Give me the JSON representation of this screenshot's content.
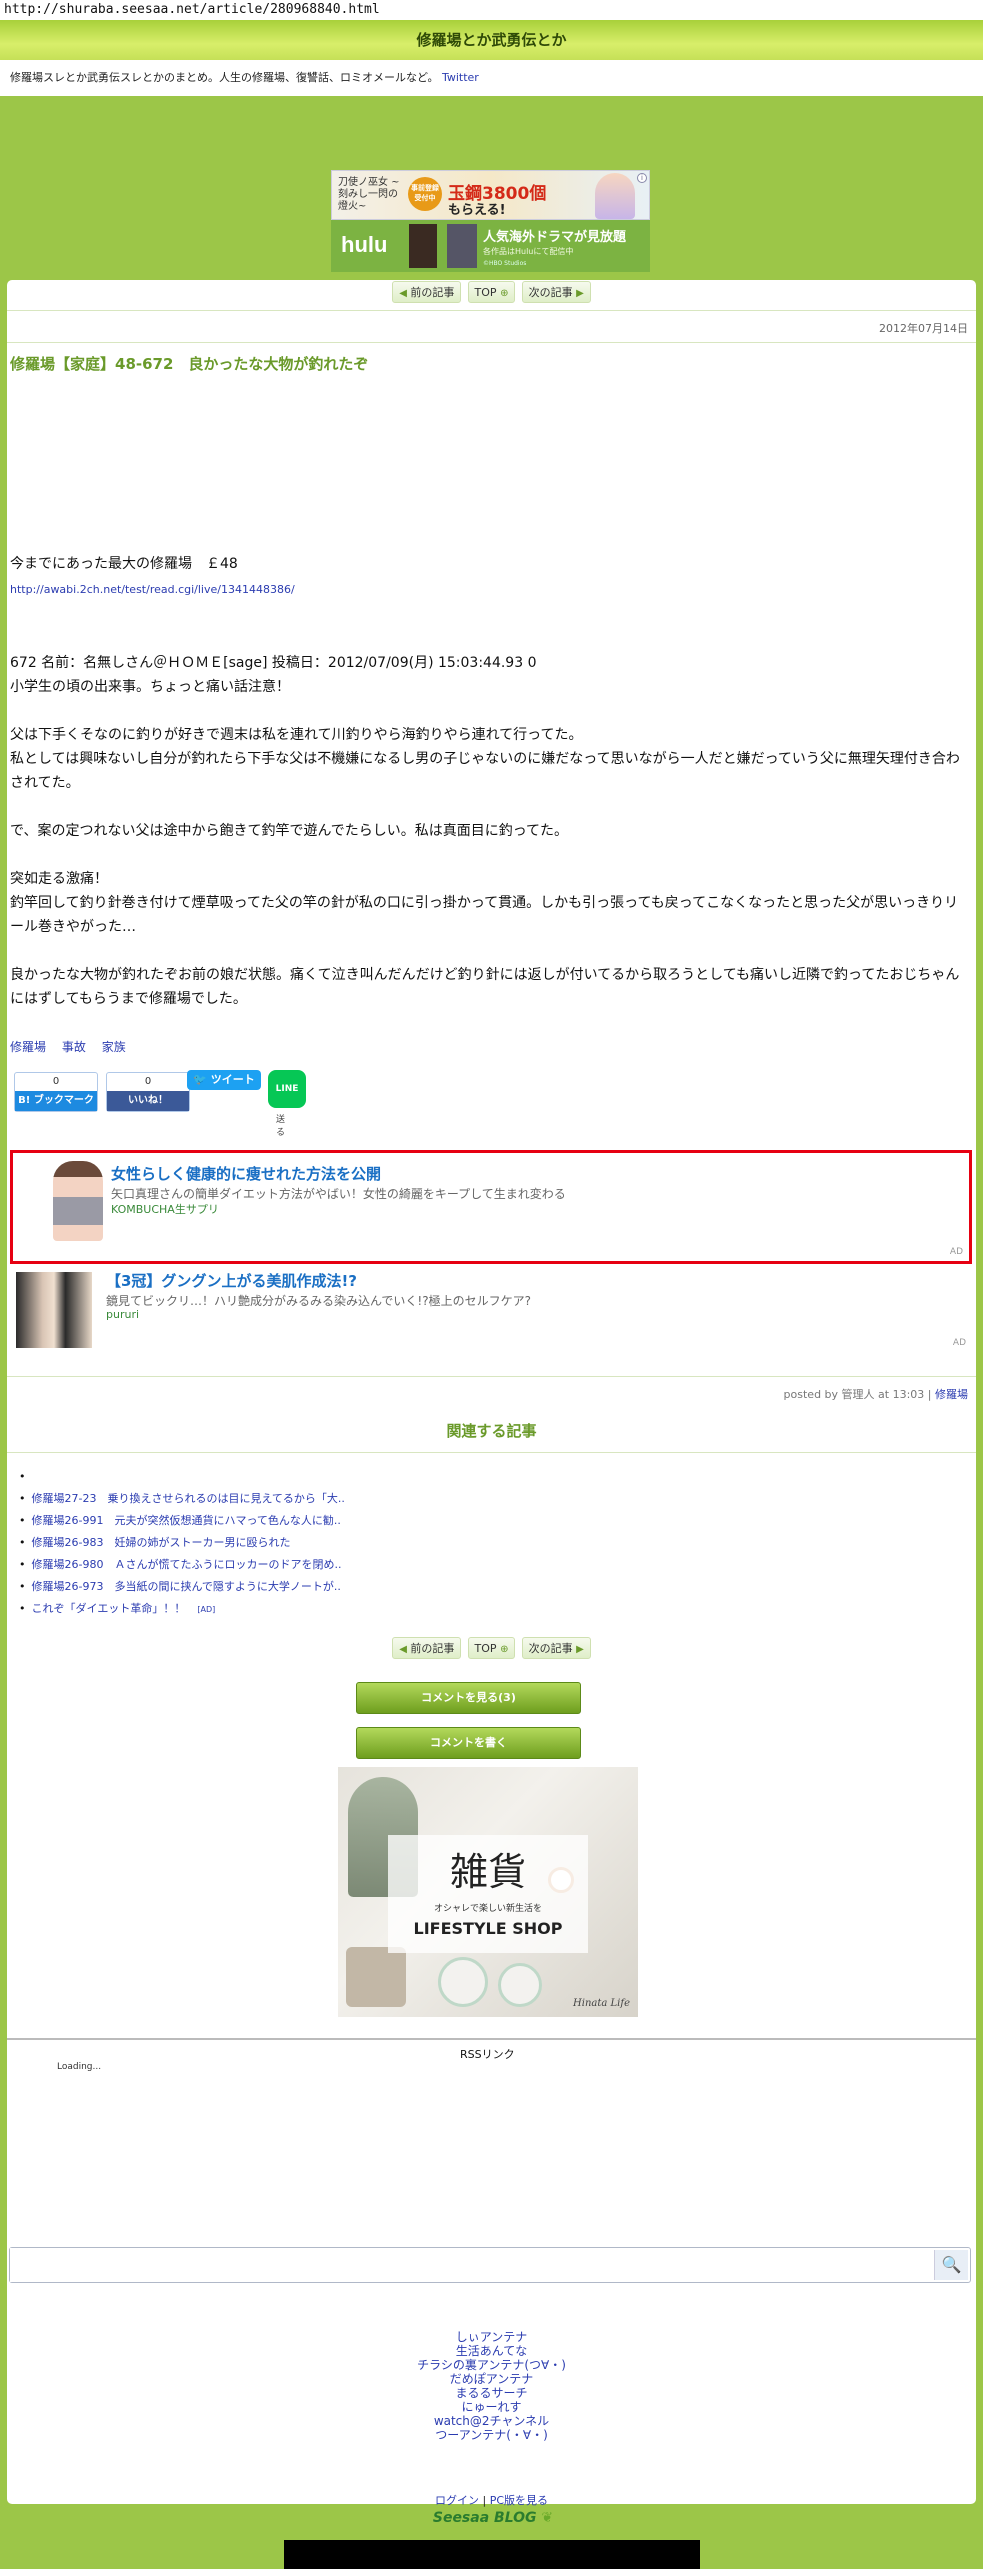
{
  "url": "http://shuraba.seesaa.net/article/280968840.html",
  "site_title": "修羅場とか武勇伝とか",
  "description": "修羅場スレとか武勇伝スレとかのまとめ。人生の修羅場、復讐話、ロミオメールなど。",
  "twitter_link": "Twitter",
  "ad_top": {
    "logo": "刀使ノ巫女 ~刻みし一閃の燈火~",
    "badge": "事前登録受付中",
    "headline": "玉鋼3800個",
    "sub": "もらえる!",
    "hulu_logo": "hulu",
    "hulu_title": "人気海外ドラマが見放題",
    "hulu_sub": "各作品はHuluにて配信中",
    "hulu_credit": "©HBO Studios"
  },
  "nav": {
    "prev": "前の記事",
    "top": "TOP",
    "next": "次の記事"
  },
  "date": "2012年07月14日",
  "article": {
    "title": "修羅場【家庭】48-672　良かったな大物が釣れたぞ",
    "intro": "今までにあった最大の修羅場　￡48",
    "source_link": "http://awabi.2ch.net/test/read.cgi/live/1341448386/",
    "header_line": "672 名前：名無しさん＠ＨＯＭＥ[sage] 投稿日：2012/07/09(月) 15:03:44.93 0",
    "p1": "小学生の頃の出来事。ちょっと痛い話注意！",
    "p2": "父は下手くそなのに釣りが好きで週末は私を連れて川釣りやら海釣りやら連れて行ってた。",
    "p3": "私としては興味ないし自分が釣れたら下手な父は不機嫌になるし男の子じゃないのに嫌だなって思いながら一人だと嫌だっていう父に無理矢理付き合わされてた。",
    "p4": "で、案の定つれない父は途中から飽きて釣竿で遊んでたらしい。私は真面目に釣ってた。",
    "p5": "突如走る激痛！",
    "p6": "釣竿回して釣り針巻き付けて煙草吸ってた父の竿の針が私の口に引っ掛かって貫通。しかも引っ張っても戻ってこなくなったと思った父が思いっきりリール巻きやがった…",
    "p7": "良かったな大物が釣れたぞお前の娘だ状態。痛くて泣き叫んだんだけど釣り針には返しが付いてるから取ろうとしても痛いし近隣で釣ってたおじちゃんにはずしてもらうまで修羅場でした。"
  },
  "tags": [
    "修羅場",
    "事故",
    "家族"
  ],
  "share": {
    "hatena_count": "0",
    "hatena_label": "B! ブックマーク",
    "fb_count": "0",
    "fb_label": "いいね！",
    "tweet": "ツイート",
    "line": "LINE",
    "line_send": "送る"
  },
  "ad_red": {
    "title": "女性らしく健康的に痩せれた方法を公開",
    "desc": "矢口真理さんの簡単ダイエット方法がやばい！女性の綺麗をキープして生まれ変わる",
    "sponsor": "KOMBUCHA生サプリ",
    "tag": "AD"
  },
  "ad_second": {
    "title": "【3冠】グングン上がる美肌作成法!?",
    "desc": "鏡見てビックリ…！ハリ艶成分がみるみる染み込んでいく!?極上のセルフケア?",
    "sponsor": "pururi",
    "tag": "AD"
  },
  "posted_by": "posted by 管理人 at 13:03 | ",
  "posted_cat": "修羅場",
  "related_title": "関連する記事",
  "related": [
    "",
    "修羅場27-23　乗り換えさせられるのは目に見えてるから「大..",
    "修羅場26-991　元夫が突然仮想通貨にハマって色んな人に勧..",
    "修羅場26-983　妊婦の姉がストーカー男に殴られた",
    "修羅場26-980　Ａさんが慌てたふうにロッカーのドアを閉め..",
    "修羅場26-973　多当紙の間に挟んで隠すように大学ノートが.."
  ],
  "related_ad": "これぞ「ダイエット革命」！！",
  "related_ad_tag": "[AD]",
  "btn_view_comments": "コメントを見る(3)",
  "btn_write_comment": "コメントを書く",
  "shop_ad": {
    "kanji": "雑貨",
    "sub": "オシャレで楽しい新生活を",
    "title": "LIFESTYLE SHOP",
    "brand": "Hinata Life"
  },
  "rss": "RSSリンク",
  "loading": "Loading...",
  "search": {
    "placeholder": "",
    "button": "🔍"
  },
  "antenna": [
    "しぃアンテナ",
    "生活あんてな",
    "チラシの裏アンテナ(つ∀・)",
    "だめぽアンテナ",
    "まるるサーチ",
    "にゅーれす",
    "watch@2チャンネル",
    "つーアンテナ(・∀・)"
  ],
  "footer": {
    "login": "ログイン",
    "sep": " | ",
    "pc": "PC版を見る",
    "brand": "Seesaa BLOG"
  },
  "colors": {
    "page_bg": "#9cc648",
    "accent": "#6a9a2a",
    "link": "#2b3cb0",
    "ad_border": "#e60012"
  }
}
